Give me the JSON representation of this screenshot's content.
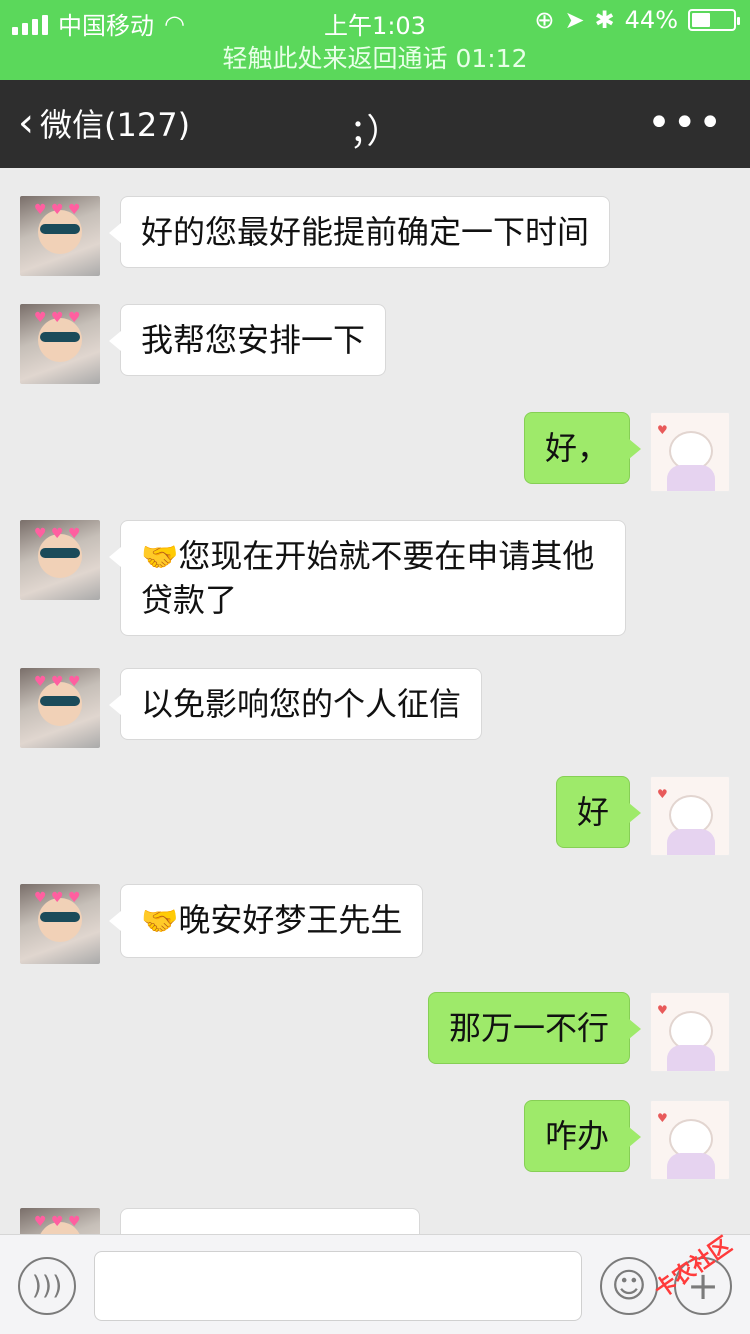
{
  "status": {
    "carrier": "中国移动",
    "time": "上午1:03",
    "battery": "44%",
    "battery_level": 0.44
  },
  "call_banner": "轻触此处来返回通话 01:12",
  "nav": {
    "back_label": "微信(127)",
    "title": "；）",
    "more": "•••"
  },
  "messages": [
    {
      "from": "them",
      "text": "好的您最好能提前确定一下时间"
    },
    {
      "from": "them",
      "text": "我帮您安排一下"
    },
    {
      "from": "me",
      "text": "好，"
    },
    {
      "from": "them",
      "emoji": "🤝",
      "text": "您现在开始就不要在申请其他贷款了"
    },
    {
      "from": "them",
      "text": "以免影响您的个人征信"
    },
    {
      "from": "me",
      "text": "好"
    },
    {
      "from": "them",
      "emoji": "🤝",
      "text": "晚安好梦王先生"
    },
    {
      "from": "me",
      "text": "那万一不行"
    },
    {
      "from": "me",
      "text": "咋办"
    }
  ],
  "watermark": "卡农社区"
}
